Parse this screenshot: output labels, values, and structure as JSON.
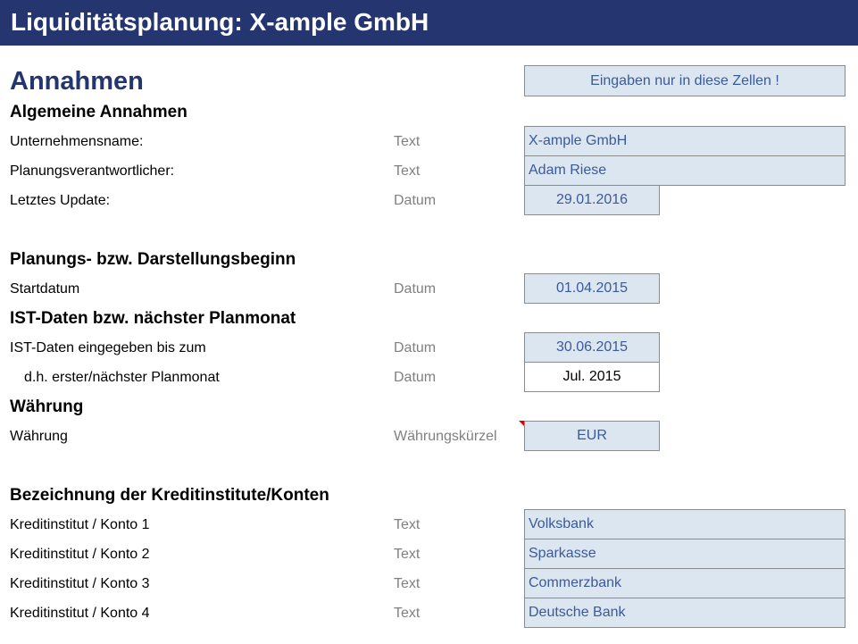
{
  "header": {
    "title": "Liquiditätsplanung: X-ample GmbH"
  },
  "section_title": "Annahmen",
  "hint": "Eingaben nur in diese Zellen !",
  "general": {
    "heading": "Algemeine Annahmen",
    "rows": [
      {
        "label": "Unternehmensname:",
        "type": "Text",
        "value": "X-ample GmbH"
      },
      {
        "label": "Planungsverantwortlicher:",
        "type": "Text",
        "value": "Adam Riese"
      },
      {
        "label": "Letztes Update:",
        "type": "Datum",
        "value": "29.01.2016"
      }
    ]
  },
  "start": {
    "heading": "Planungs- bzw. Darstellungsbeginn",
    "rows": [
      {
        "label": "Startdatum",
        "type": "Datum",
        "value": "01.04.2015"
      }
    ]
  },
  "ist": {
    "heading": "IST-Daten bzw. nächster Planmonat",
    "rows": [
      {
        "label": "IST-Daten eingegeben bis zum",
        "type": "Datum",
        "value": "30.06.2015"
      },
      {
        "label": "d.h. erster/nächster Planmonat",
        "type": "Datum",
        "value": "Jul. 2015"
      }
    ]
  },
  "currency": {
    "heading": "Währung",
    "rows": [
      {
        "label": "Währung",
        "type": "Währungskürzel",
        "value": "EUR"
      }
    ]
  },
  "banks": {
    "heading": "Bezeichnung der Kreditinstitute/Konten",
    "rows": [
      {
        "label": "Kreditinstitut / Konto 1",
        "type": "Text",
        "value": "Volksbank"
      },
      {
        "label": "Kreditinstitut / Konto 2",
        "type": "Text",
        "value": "Sparkasse"
      },
      {
        "label": "Kreditinstitut / Konto 3",
        "type": "Text",
        "value": "Commerzbank"
      },
      {
        "label": "Kreditinstitut / Konto 4",
        "type": "Text",
        "value": "Deutsche Bank"
      }
    ]
  },
  "colors": {
    "header_bg": "#253570",
    "input_bg": "#dce6f1",
    "input_text": "#3a5a98",
    "type_text": "#808080",
    "comment_flag": "#e00000"
  }
}
